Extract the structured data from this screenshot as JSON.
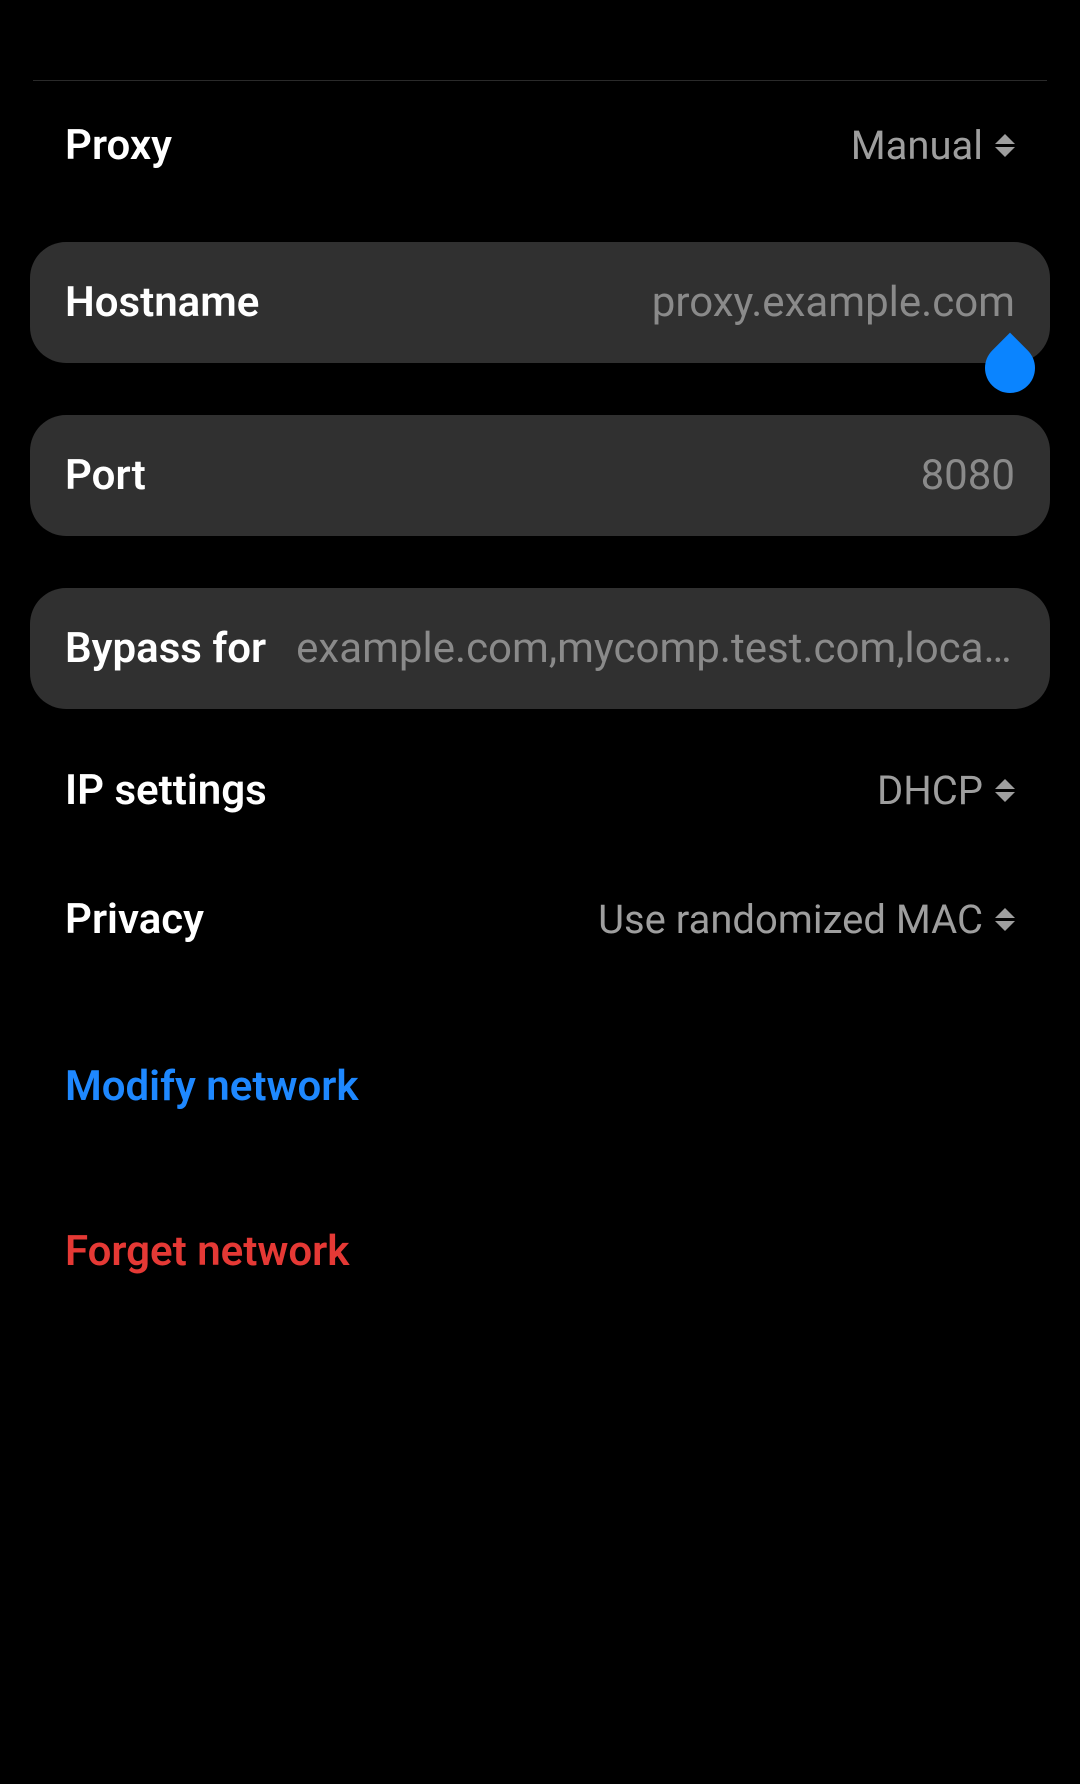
{
  "proxy": {
    "label": "Proxy",
    "value": "Manual"
  },
  "hostname": {
    "label": "Hostname",
    "placeholder": "proxy.example.com",
    "value": ""
  },
  "port": {
    "label": "Port",
    "placeholder": "8080",
    "value": ""
  },
  "bypass": {
    "label": "Bypass for",
    "placeholder": "example.com,mycomp.test.com,localhost"
  },
  "ip_settings": {
    "label": "IP settings",
    "value": "DHCP"
  },
  "privacy": {
    "label": "Privacy",
    "value": "Use randomized MAC"
  },
  "actions": {
    "modify": "Modify network",
    "forget": "Forget network"
  },
  "colors": {
    "accent": "#0a84ff",
    "danger": "#e53935",
    "card_bg": "#303030",
    "muted": "#9e9e9e"
  }
}
